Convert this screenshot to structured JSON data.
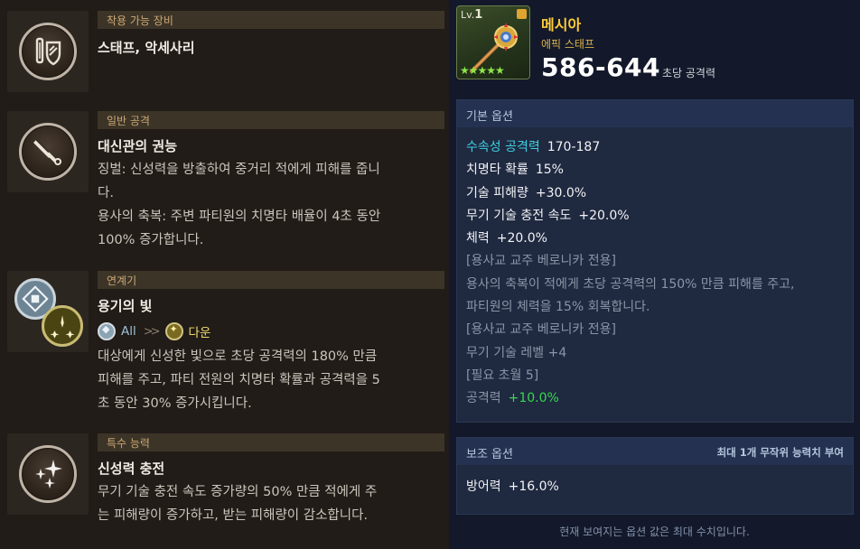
{
  "left": {
    "sections": [
      {
        "header": "착용 가능 장비",
        "title": "스태프, 악세사리",
        "icon": "staff-shield-icon",
        "lines": []
      },
      {
        "header": "일반 공격",
        "title": "대신관의 권능",
        "icon": "sword-icon",
        "lines": [
          "징벌: 신성력을 방출하여 중거리 적에게 피해를 줍니",
          "다.",
          "용사의 축복: 주변 파티원의 치명타 배율이 4초 동안",
          "100% 증가합니다."
        ]
      },
      {
        "header": "연계기",
        "title": "용기의 빛",
        "icon": "chain-skill-icon",
        "chain": {
          "from": "All",
          "to": "다운",
          "from_icon": "rune-icon",
          "to_icon": "sparkle-icon"
        },
        "lines": [
          "대상에게 신성한 빛으로 초당 공격력의 180% 만큼",
          "피해를 주고, 파티 전원의 치명타 확률과 공격력을 5",
          "초 동안 30% 증가시킵니다."
        ]
      },
      {
        "header": "특수 능력",
        "title": "신성력 충전",
        "icon": "holy-sparkle-icon",
        "lines": [
          "무기 기술 충전 속도 증가량의 50% 만큼 적에게 주",
          "는 피해량이 증가하고, 받는 피해량이 감소합니다."
        ]
      }
    ]
  },
  "item": {
    "level_prefix": "Lv.",
    "level": "1",
    "stars": "★★★★★",
    "name": "메시아",
    "grade": "에픽 스태프",
    "attack": "586-644",
    "attack_label": "초당 공격력",
    "accent": "#ffcc3b"
  },
  "base_options": {
    "title": "기본 옵션",
    "rows": [
      {
        "k": "수속성 공격력",
        "v": "170-187",
        "kc": "cyan",
        "vc": "white"
      },
      {
        "k": "치명타 확률",
        "v": "15%",
        "kc": "white",
        "vc": "white"
      },
      {
        "k": "기술 피해량",
        "v": "+30.0%",
        "kc": "white",
        "vc": "white"
      },
      {
        "k": "무기 기술 충전 속도",
        "v": "+20.0%",
        "kc": "white",
        "vc": "white"
      },
      {
        "k": "체력",
        "v": "+20.0%",
        "kc": "white",
        "vc": "white"
      },
      {
        "k": "[용사교 교주 베로니카 전용]",
        "v": "",
        "kc": "gray",
        "vc": "gray"
      },
      {
        "k": "용사의 축복이 적에게 초당 공격력의 150% 만큼 피해를 주고,",
        "v": "",
        "kc": "gray",
        "vc": "gray"
      },
      {
        "k": "파티원의 체력을 15% 회복합니다.",
        "v": "",
        "kc": "gray",
        "vc": "gray"
      },
      {
        "k": "[용사교 교주 베로니카 전용]",
        "v": "",
        "kc": "gray",
        "vc": "gray"
      },
      {
        "k": "무기 기술 레벨 +4",
        "v": "",
        "kc": "gray",
        "vc": "gray"
      },
      {
        "k": "[필요 초월 5]",
        "v": "",
        "kc": "gray",
        "vc": "gray"
      },
      {
        "k": "공격력",
        "v": "+10.0%",
        "kc": "gray",
        "vc": "green"
      }
    ]
  },
  "sub_options": {
    "title": "보조 옵션",
    "note": "최대 1개 무작위 능력치 부여",
    "rows": [
      {
        "k": "방어력",
        "v": "+16.0%",
        "kc": "white",
        "vc": "white"
      }
    ]
  },
  "footer": "현재 보여지는 옵션 값은 최대 수치입니다."
}
